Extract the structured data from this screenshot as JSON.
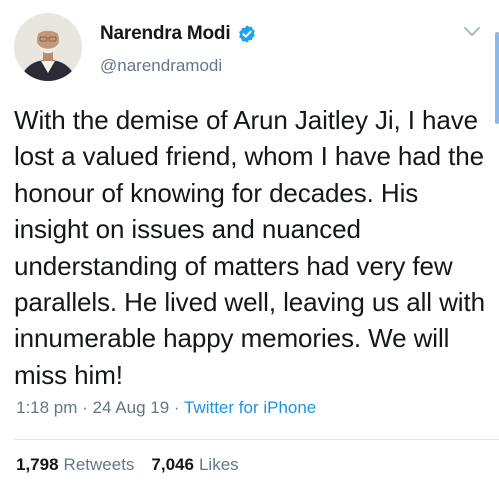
{
  "user": {
    "display_name": "Narendra Modi",
    "handle": "@narendramodi",
    "verified": true
  },
  "tweet": {
    "text": "With the demise of Arun Jaitley Ji, I have lost a valued friend, whom I have had the honour of knowing for decades. His insight on issues and nuanced understanding of matters had very few parallels. He lived well, leaving us all with innumerable happy memories. We will miss him!",
    "time": "1:18 pm",
    "separator": "·",
    "date": "24 Aug 19",
    "source": "Twitter for iPhone"
  },
  "stats": {
    "retweets_count": "1,798",
    "retweets_label": "Retweets",
    "likes_count": "7,046",
    "likes_label": "Likes"
  },
  "icons": {
    "verified": "verified-badge-icon",
    "menu": "chevron-down-icon"
  },
  "colors": {
    "link": "#1b95e0",
    "secondary_text": "#657786",
    "primary_text": "#14171a",
    "verified": "#1da1f2"
  }
}
